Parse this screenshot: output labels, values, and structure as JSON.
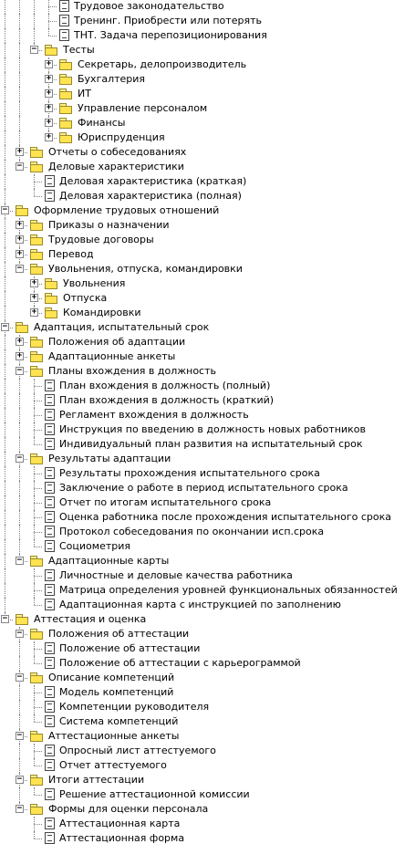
{
  "tree": [
    {
      "d": 3,
      "t": "leaf",
      "label": "Трудовое законодательство"
    },
    {
      "d": 3,
      "t": "leaf",
      "label": "Тренинг. Приобрести или потерять"
    },
    {
      "d": 3,
      "t": "leaf",
      "label": "ТНТ. Задача перепозиционирования"
    },
    {
      "d": 2,
      "t": "open",
      "label": "Тесты"
    },
    {
      "d": 3,
      "t": "closed",
      "label": "Секретарь, делопроизводитель"
    },
    {
      "d": 3,
      "t": "closed",
      "label": "Бухгалтерия"
    },
    {
      "d": 3,
      "t": "closed",
      "label": "ИТ"
    },
    {
      "d": 3,
      "t": "closed",
      "label": "Управление персоналом"
    },
    {
      "d": 3,
      "t": "closed",
      "label": "Финансы"
    },
    {
      "d": 3,
      "t": "closed",
      "label": "Юриспруденция"
    },
    {
      "d": 1,
      "t": "closed",
      "label": "Отчеты о собеседованиях"
    },
    {
      "d": 1,
      "t": "open",
      "label": "Деловые характеристики"
    },
    {
      "d": 2,
      "t": "leaf",
      "label": "Деловая характеристика (краткая)"
    },
    {
      "d": 2,
      "t": "leaf",
      "label": "Деловая характеристика (полная)"
    },
    {
      "d": 0,
      "t": "open",
      "label": "Оформление трудовых отношений"
    },
    {
      "d": 1,
      "t": "closed",
      "label": "Приказы о назначении"
    },
    {
      "d": 1,
      "t": "closed",
      "label": "Трудовые договоры"
    },
    {
      "d": 1,
      "t": "closed",
      "label": "Перевод"
    },
    {
      "d": 1,
      "t": "open",
      "label": "Увольнения, отпуска, командировки"
    },
    {
      "d": 2,
      "t": "closed",
      "label": "Увольнения"
    },
    {
      "d": 2,
      "t": "closed",
      "label": "Отпуска"
    },
    {
      "d": 2,
      "t": "closed",
      "label": "Командировки"
    },
    {
      "d": 0,
      "t": "open",
      "label": "Адаптация, испытательный срок"
    },
    {
      "d": 1,
      "t": "closed",
      "label": "Положения об адаптации"
    },
    {
      "d": 1,
      "t": "closed",
      "label": "Адаптационные анкеты"
    },
    {
      "d": 1,
      "t": "open",
      "label": "Планы вхождения в должность"
    },
    {
      "d": 2,
      "t": "leaf",
      "label": "План вхождения в должность (полный)"
    },
    {
      "d": 2,
      "t": "leaf",
      "label": "План вхождения в должность (краткий)"
    },
    {
      "d": 2,
      "t": "leaf",
      "label": "Регламент вхождения в должность"
    },
    {
      "d": 2,
      "t": "leaf",
      "label": "Инструкция по введению в должность новых работников"
    },
    {
      "d": 2,
      "t": "leaf",
      "label": "Индивидуальный план развития на испытательный срок"
    },
    {
      "d": 1,
      "t": "open",
      "label": "Результаты адаптации"
    },
    {
      "d": 2,
      "t": "leaf",
      "label": "Результаты прохождения испытательного срока"
    },
    {
      "d": 2,
      "t": "leaf",
      "label": "Заключение о работе в период испытательного срока"
    },
    {
      "d": 2,
      "t": "leaf",
      "label": "Отчет по итогам испытательного срока"
    },
    {
      "d": 2,
      "t": "leaf",
      "label": "Оценка работника после прохождения испытательного срока"
    },
    {
      "d": 2,
      "t": "leaf",
      "label": "Протокол собеседования по окончании исп.срока"
    },
    {
      "d": 2,
      "t": "leaf",
      "label": "Социометрия"
    },
    {
      "d": 1,
      "t": "open",
      "label": "Адаптационные карты"
    },
    {
      "d": 2,
      "t": "leaf",
      "label": "Личностные и деловые качества работника"
    },
    {
      "d": 2,
      "t": "leaf",
      "label": "Матрица определения уровней функциональных обязанностей"
    },
    {
      "d": 2,
      "t": "leaf",
      "label": "Адаптационная карта с инструкцией по заполнению"
    },
    {
      "d": 0,
      "t": "open",
      "label": "Аттестация и оценка"
    },
    {
      "d": 1,
      "t": "open",
      "label": "Положения об аттестации"
    },
    {
      "d": 2,
      "t": "leaf",
      "label": "Положение об аттестации"
    },
    {
      "d": 2,
      "t": "leaf",
      "label": "Положение об аттестации с карьерограммой"
    },
    {
      "d": 1,
      "t": "open",
      "label": "Описание компетенций"
    },
    {
      "d": 2,
      "t": "leaf",
      "label": "Модель компетенций"
    },
    {
      "d": 2,
      "t": "leaf",
      "label": "Компетенции руководителя"
    },
    {
      "d": 2,
      "t": "leaf",
      "label": "Система компетенций"
    },
    {
      "d": 1,
      "t": "open",
      "label": "Аттестационные анкеты"
    },
    {
      "d": 2,
      "t": "leaf",
      "label": "Опросный лист аттестуемого"
    },
    {
      "d": 2,
      "t": "leaf",
      "label": "Отчет аттестуемого"
    },
    {
      "d": 1,
      "t": "open",
      "label": "Итоги аттестации"
    },
    {
      "d": 2,
      "t": "leaf",
      "label": "Решение аттестационной комиссии"
    },
    {
      "d": 1,
      "t": "open",
      "label": "Формы для оценки персонала"
    },
    {
      "d": 2,
      "t": "leaf",
      "label": "Аттестационная карта"
    },
    {
      "d": 2,
      "t": "leaf",
      "label": "Аттестационная форма"
    }
  ]
}
